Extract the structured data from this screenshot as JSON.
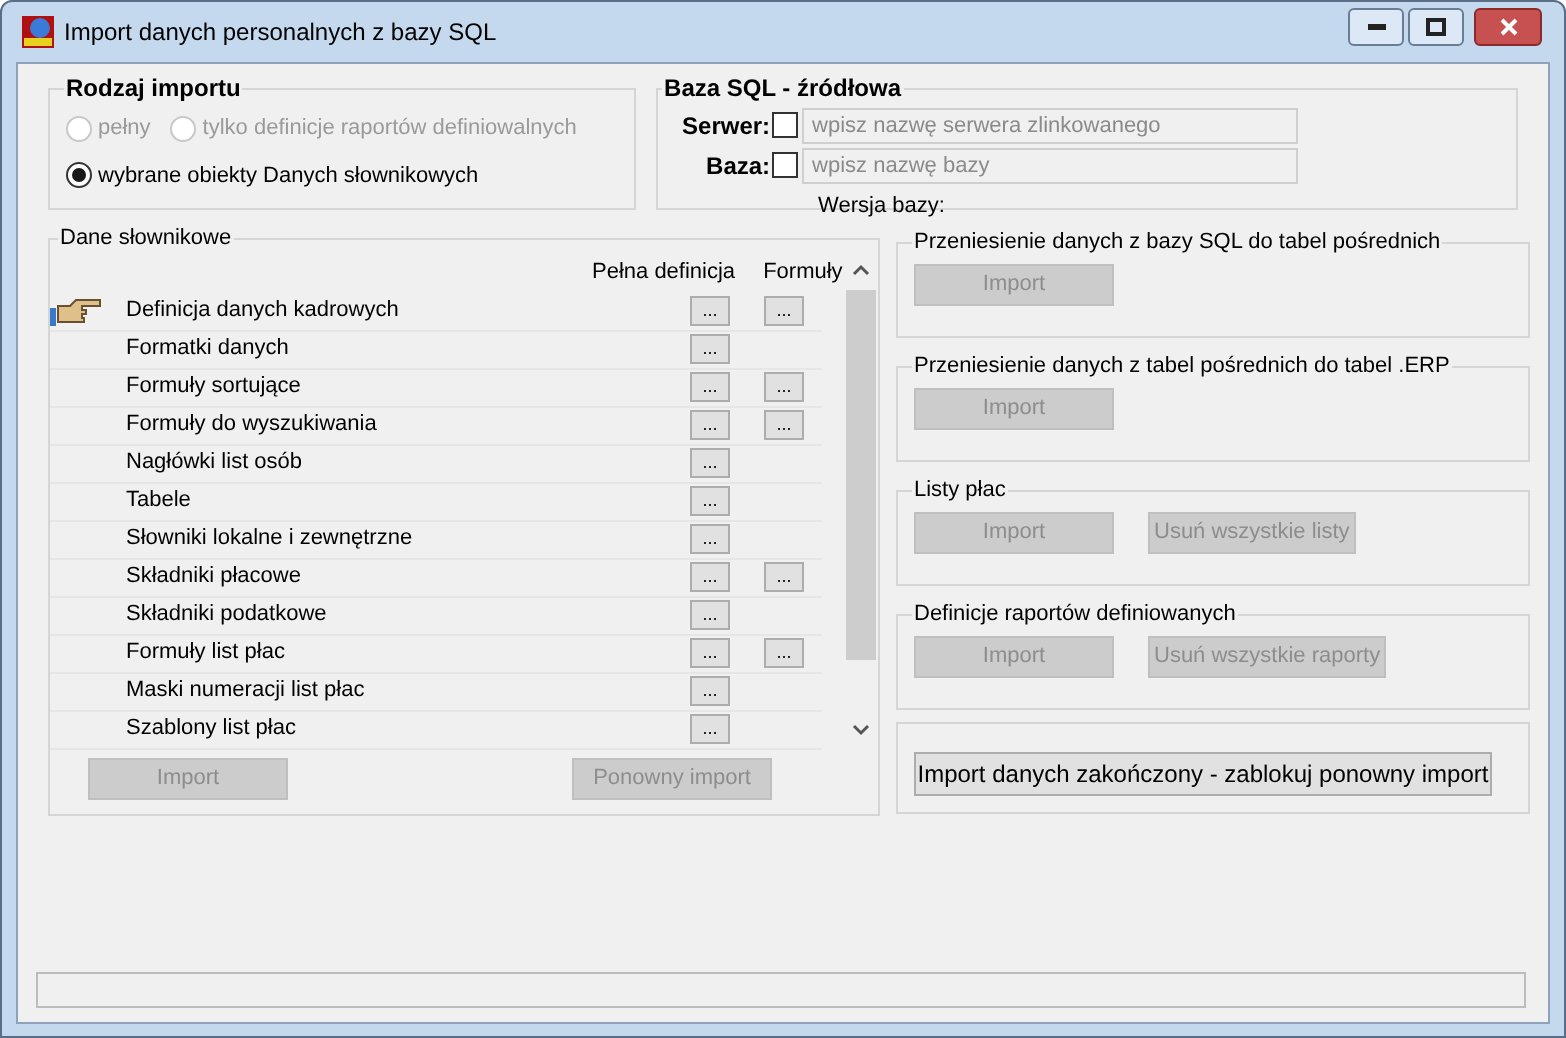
{
  "window": {
    "title": "Import danych personalnych z bazy SQL"
  },
  "import_type": {
    "title": "Rodzaj importu",
    "options": [
      {
        "label": "pełny",
        "selected": false,
        "disabled": true
      },
      {
        "label": "tylko definicje raportów definiowalnych",
        "selected": false,
        "disabled": true
      },
      {
        "label": "wybrane obiekty Danych słownikowych",
        "selected": true,
        "disabled": false
      }
    ]
  },
  "sql_source": {
    "title": "Baza SQL - źródłowa",
    "fields": [
      {
        "label": "Serwer:",
        "checked": false,
        "placeholder": "wpisz nazwę serwera zlinkowanego"
      },
      {
        "label": "Baza:",
        "checked": false,
        "placeholder": "wpisz nazwę bazy"
      }
    ],
    "version_label": "Wersja bazy:"
  },
  "dictionary": {
    "title": "Dane słownikowe",
    "columns": [
      "Pełna definicja",
      "Formuły"
    ],
    "rows": [
      {
        "label": "Definicja danych kadrowych",
        "current": true,
        "definition_button": "...",
        "formula_button": "..."
      },
      {
        "label": "Formatki danych",
        "current": false,
        "definition_button": "..."
      },
      {
        "label": "Formuły sortujące",
        "current": false,
        "definition_button": "...",
        "formula_button": "..."
      },
      {
        "label": "Formuły do wyszukiwania",
        "current": false,
        "definition_button": "...",
        "formula_button": "..."
      },
      {
        "label": "Nagłówki list osób",
        "current": false,
        "definition_button": "..."
      },
      {
        "label": "Tabele",
        "current": false,
        "definition_button": "..."
      },
      {
        "label": "Słowniki lokalne i zewnętrzne",
        "current": false,
        "definition_button": "..."
      },
      {
        "label": "Składniki płacowe",
        "current": false,
        "definition_button": "...",
        "formula_button": "..."
      },
      {
        "label": "Składniki podatkowe",
        "current": false,
        "definition_button": "..."
      },
      {
        "label": "Formuły list płac",
        "current": false,
        "definition_button": "...",
        "formula_button": "..."
      },
      {
        "label": "Maski numeracji list płac",
        "current": false,
        "definition_button": "..."
      },
      {
        "label": "Szablony list płac",
        "current": false,
        "definition_button": "..."
      }
    ],
    "buttons": [
      {
        "label": "Import",
        "disabled": true
      },
      {
        "label": "Ponowny import",
        "disabled": true
      }
    ]
  },
  "steps": [
    {
      "title": "Przeniesienie danych z bazy SQL do tabel pośrednich",
      "buttons": [
        {
          "label": "Import",
          "disabled": true
        }
      ]
    },
    {
      "title": "Przeniesienie danych z tabel pośrednich do tabel .ERP",
      "buttons": [
        {
          "label": "Import",
          "disabled": true
        }
      ]
    },
    {
      "title": "Listy płac",
      "buttons": [
        {
          "label": "Import",
          "disabled": true
        },
        {
          "label": "Usuń wszystkie listy",
          "disabled": true
        }
      ]
    },
    {
      "title": "Definicje raportów definiowanych",
      "buttons": [
        {
          "label": "Import",
          "disabled": true
        },
        {
          "label": "Usuń wszystkie raporty",
          "disabled": true
        }
      ]
    },
    {
      "buttons": [
        {
          "label": "Import danych zakończony - zablokuj ponowny import",
          "disabled": false
        }
      ]
    }
  ]
}
